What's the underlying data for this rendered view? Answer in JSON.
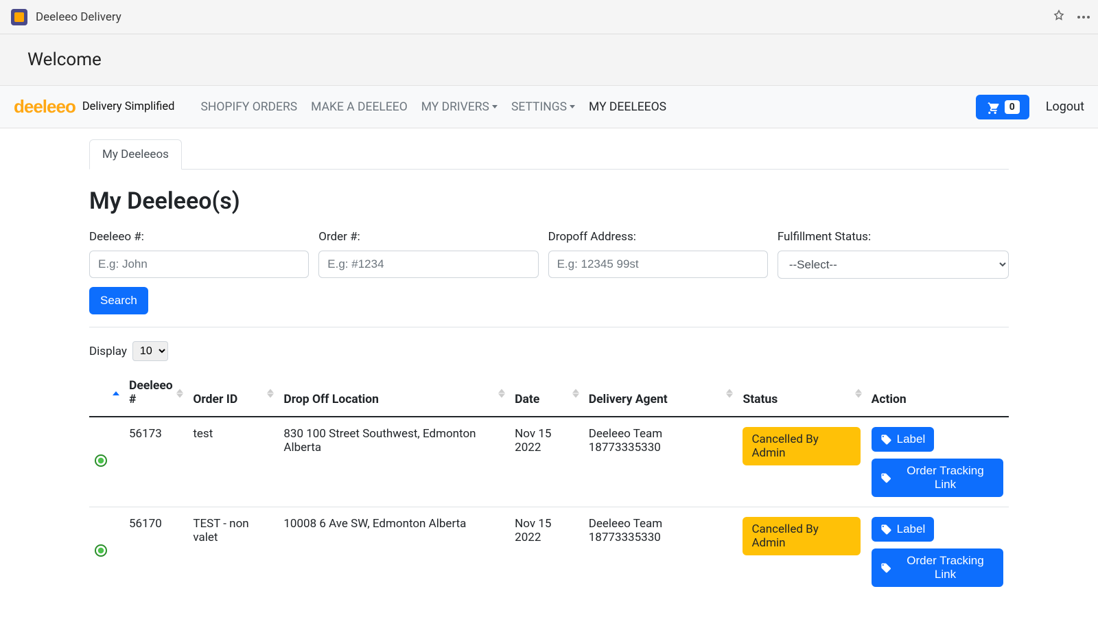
{
  "browser": {
    "app_title": "Deeleeo Delivery"
  },
  "welcome": "Welcome",
  "brand": {
    "logo": "deeleeo",
    "tagline": "Delivery Simplified"
  },
  "nav": {
    "shopify_orders": "SHOPIFY ORDERS",
    "make_deeleeo": "MAKE A DEELEEO",
    "my_drivers": "MY DRIVERS",
    "settings": "SETTINGS",
    "my_deeleeos": "MY DEELEEOS",
    "cart_count": "0",
    "logout": "Logout"
  },
  "tabs": {
    "my_deeleeos": "My Deeleeos"
  },
  "page_title": "My Deeleeo(s)",
  "filters": {
    "deeleeo_num": {
      "label": "Deeleeo #:",
      "placeholder": "E.g: John"
    },
    "order_num": {
      "label": "Order #:",
      "placeholder": "E.g: #1234"
    },
    "dropoff": {
      "label": "Dropoff Address:",
      "placeholder": "E.g: 12345 99st"
    },
    "status": {
      "label": "Fulfillment Status:",
      "placeholder": "--Select--"
    },
    "search": "Search"
  },
  "display": {
    "label": "Display",
    "value": "10"
  },
  "columns": {
    "deeleeo_num": "Deeleeo #",
    "order_id": "Order ID",
    "drop_off": "Drop Off Location",
    "date": "Date",
    "agent": "Delivery Agent",
    "status": "Status",
    "action": "Action"
  },
  "actions": {
    "label": "Label",
    "tracking": "Order Tracking Link"
  },
  "rows": [
    {
      "deeleeo_num": "56173",
      "order_id": "test",
      "drop_off": "830 100 Street Southwest, Edmonton Alberta",
      "date": "Nov 15 2022",
      "agent": "Deeleeo Team 18773335330",
      "status": "Cancelled By Admin"
    },
    {
      "deeleeo_num": "56170",
      "order_id": "TEST - non valet",
      "drop_off": "10008 6 Ave SW, Edmonton Alberta",
      "date": "Nov 15 2022",
      "agent": "Deeleeo Team 18773335330",
      "status": "Cancelled By Admin"
    }
  ]
}
